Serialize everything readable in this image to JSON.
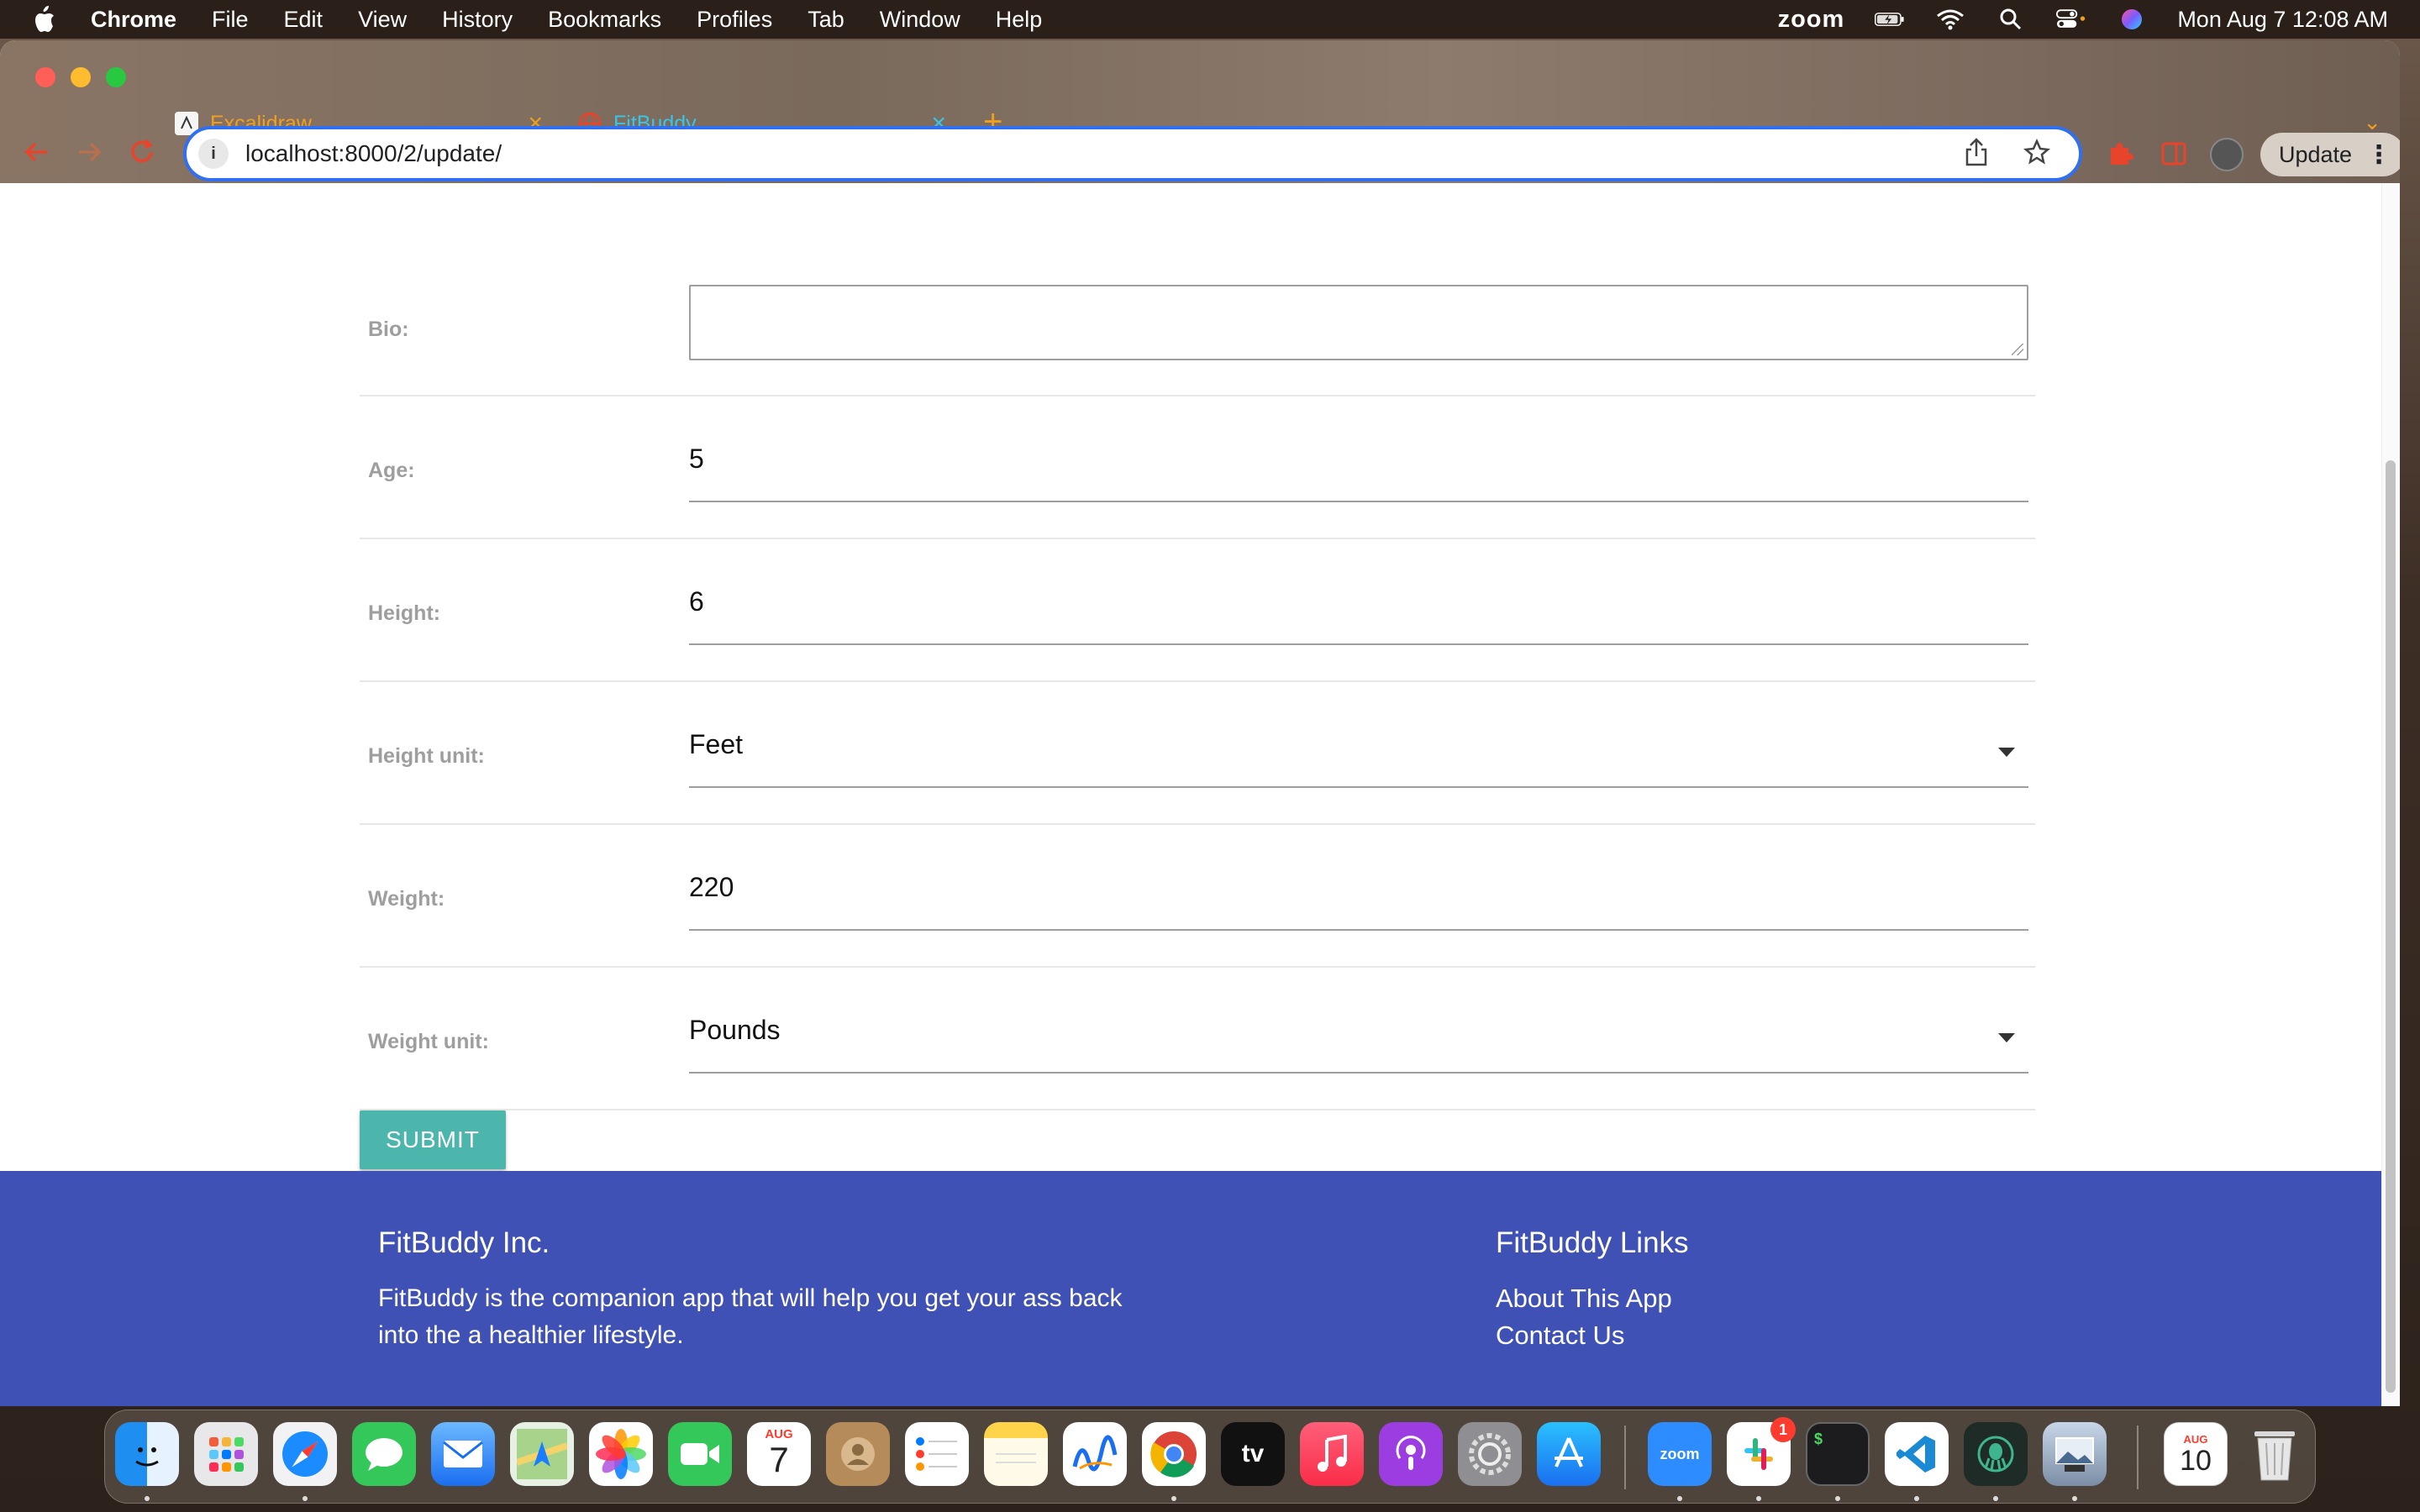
{
  "menubar": {
    "app_name": "Chrome",
    "items": [
      "File",
      "Edit",
      "View",
      "History",
      "Bookmarks",
      "Profiles",
      "Tab",
      "Window",
      "Help"
    ],
    "zoom_label": "zoom",
    "datetime": "Mon Aug 7  12:08 AM"
  },
  "browser": {
    "tabs": [
      {
        "label": "Excalidraw",
        "icon": "excalidraw-icon",
        "close": "×"
      },
      {
        "label": "FitBuddy",
        "icon": "globe-icon",
        "close": "×"
      }
    ],
    "new_tab": "+",
    "tab_list": "⌄",
    "url": "localhost:8000/2/update/",
    "update_label": "Update",
    "menu_dots": "⋮",
    "accent_color": "#2f6ff0"
  },
  "form": {
    "bio": {
      "label": "Bio:",
      "value": ""
    },
    "age": {
      "label": "Age:",
      "value": "5"
    },
    "height": {
      "label": "Height:",
      "value": "6"
    },
    "height_unit": {
      "label": "Height unit:",
      "value": "Feet"
    },
    "weight": {
      "label": "Weight:",
      "value": "220"
    },
    "weight_unit": {
      "label": "Weight unit:",
      "value": "Pounds"
    },
    "submit_label": "SUBMIT",
    "submit_color": "#4db6ac"
  },
  "footer": {
    "background": "#3f51b5",
    "company_title": "FitBuddy Inc.",
    "company_text": "FitBuddy is the companion app that will help you get your ass back into the a healthier lifestyle.",
    "links_title": "FitBuddy Links",
    "links": [
      "About This App",
      "Contact Us"
    ]
  },
  "dock": {
    "calendar_month": "AUG",
    "calendar_day": "7",
    "zoom_label": "zoom",
    "tv_label": "tv",
    "slack_badge": "1",
    "terminal_prompt": "$",
    "calendar2_month": "AUG",
    "calendar2_day": "10"
  }
}
